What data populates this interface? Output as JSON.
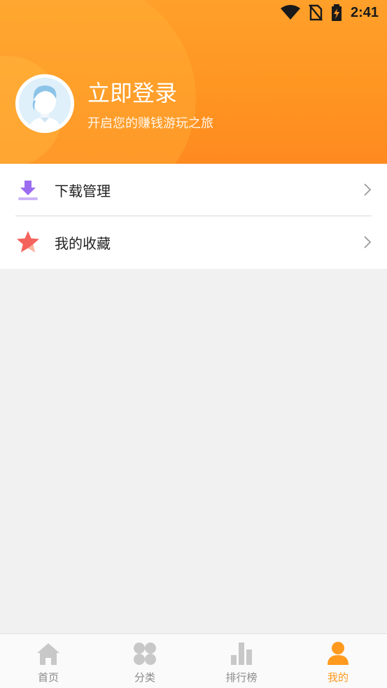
{
  "status_bar": {
    "time": "2:41",
    "icons": [
      "wifi-icon",
      "no-sim-icon",
      "battery-charging-icon"
    ]
  },
  "profile": {
    "title": "立即登录",
    "subtitle": "开启您的赚钱游玩之旅"
  },
  "menu": {
    "items": [
      {
        "label": "下载管理",
        "icon": "download-icon"
      },
      {
        "label": "我的收藏",
        "icon": "star-icon"
      }
    ]
  },
  "tabbar": {
    "tabs": [
      {
        "label": "首页",
        "icon": "home-icon",
        "active": false
      },
      {
        "label": "分类",
        "icon": "category-icon",
        "active": false
      },
      {
        "label": "排行榜",
        "icon": "ranking-icon",
        "active": false
      },
      {
        "label": "我的",
        "icon": "user-icon",
        "active": true
      }
    ]
  },
  "colors": {
    "accent": "#ff9a1f",
    "header": "#ff9522",
    "download_icon": "#9b6cf0",
    "star_icon": "#f5645c",
    "inactive": "#c8c8c8"
  }
}
